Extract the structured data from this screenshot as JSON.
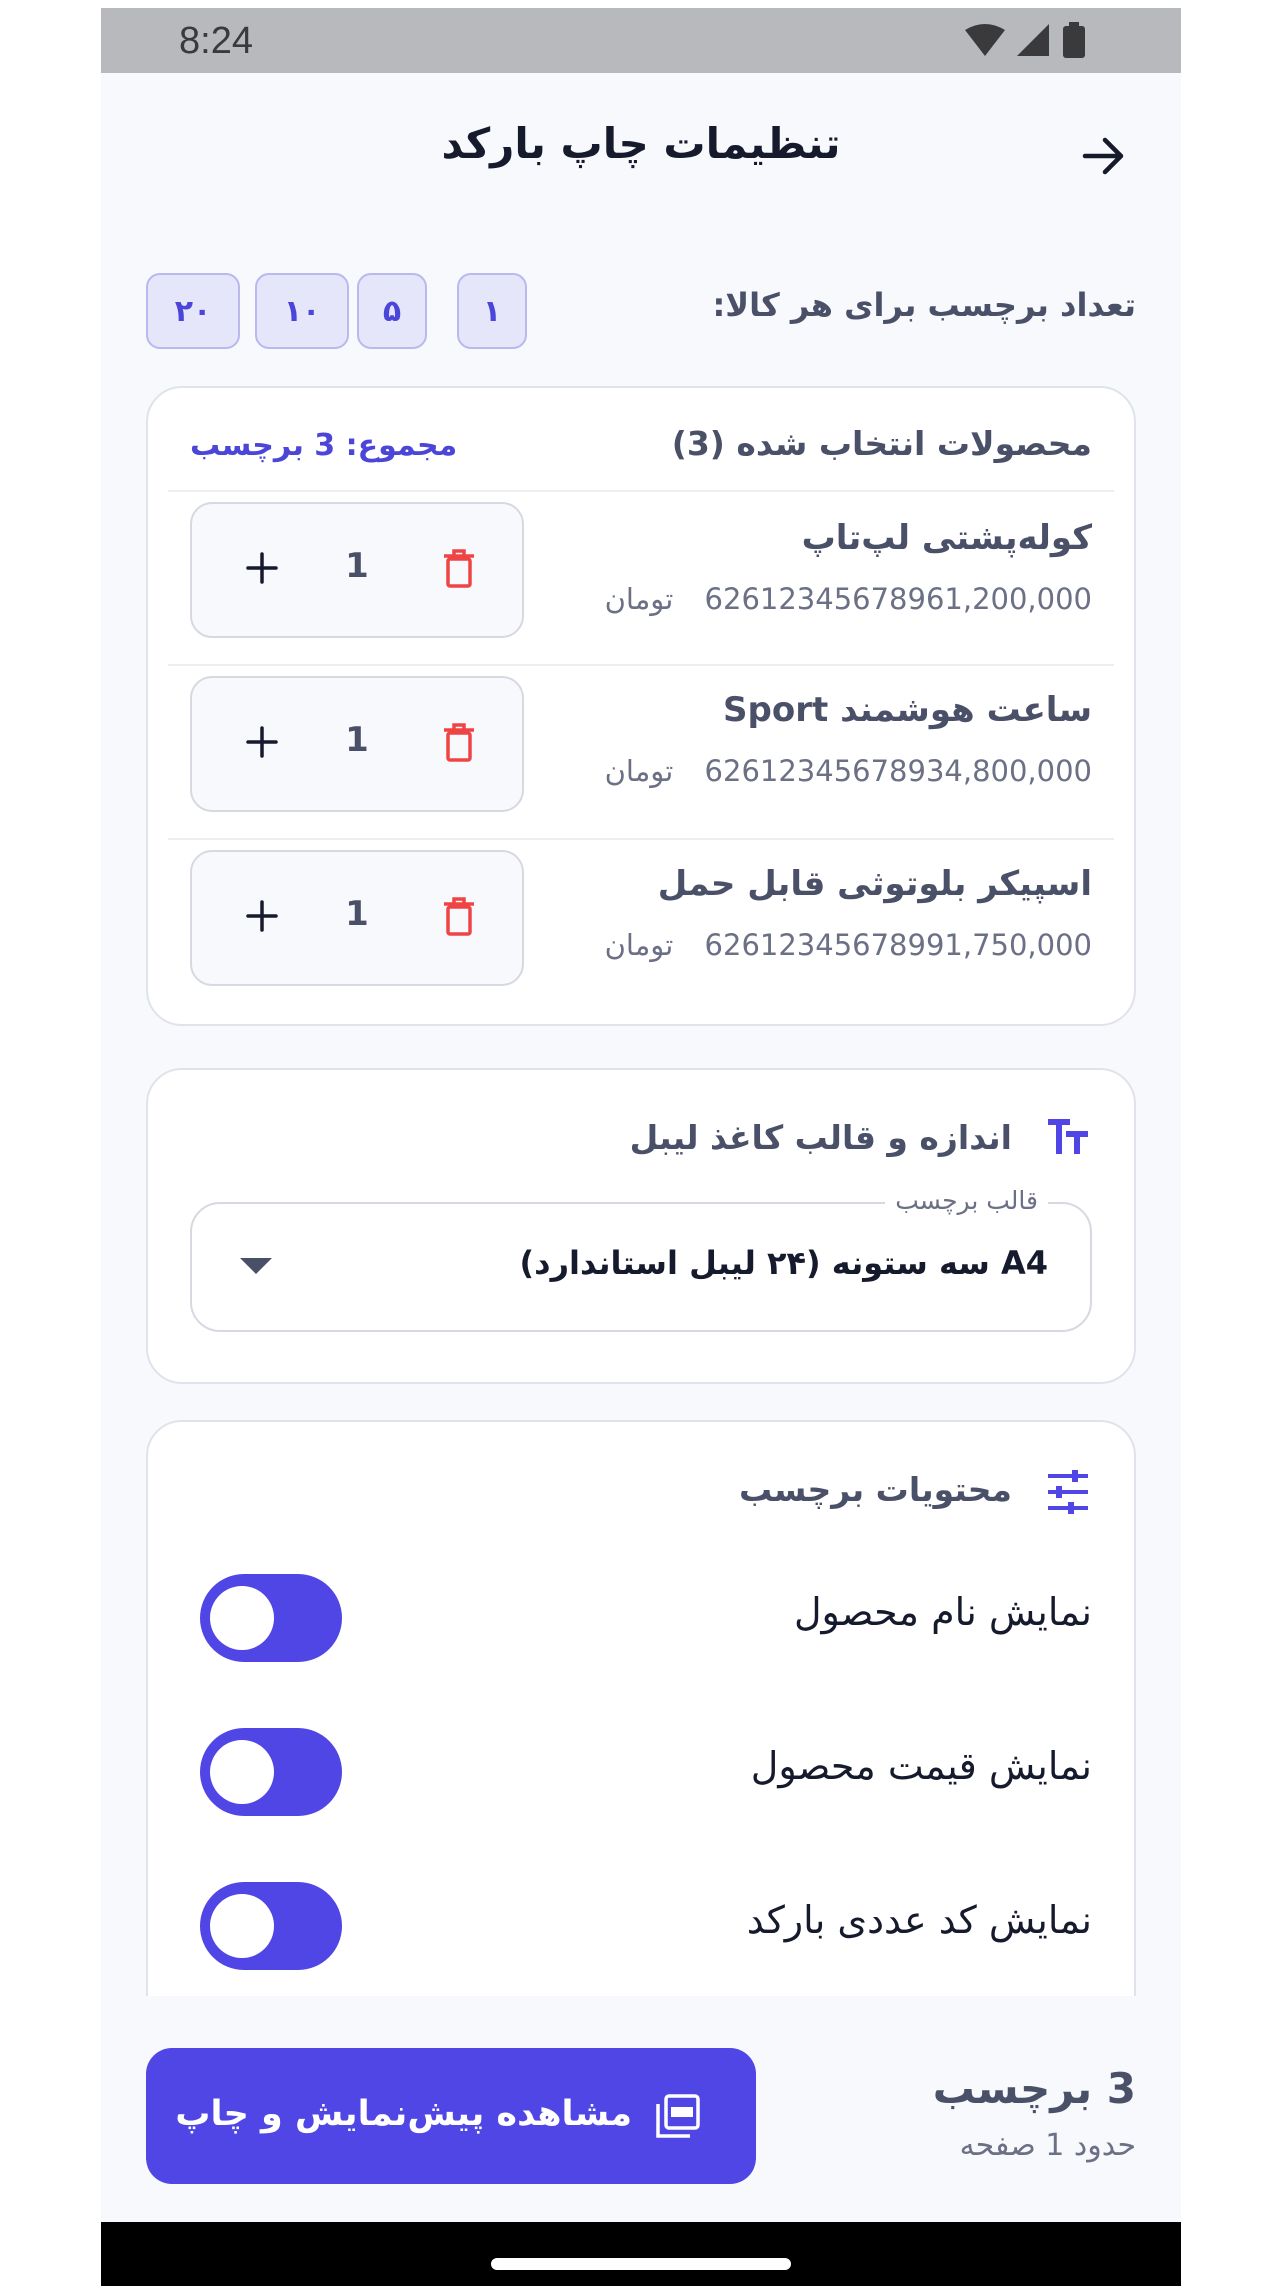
{
  "status_bar": {
    "time": "8:24"
  },
  "header": {
    "title": "تنظیمات چاپ بارکد"
  },
  "quantity": {
    "label": "تعداد برچسب برای هر کالا:",
    "chips": [
      "۱",
      "۵",
      "۱۰",
      "۲۰"
    ]
  },
  "products": {
    "title": "محصولات انتخاب شده (3)",
    "total": "مجموع: 3 برچسب",
    "items": [
      {
        "name": "کوله‌پشتی لپ‌تاپ",
        "barcode": "6261234567896",
        "price": "1,200,000 تومان",
        "qty": "1"
      },
      {
        "name": "ساعت هوشمند Sport",
        "barcode": "6261234567893",
        "price": "4,800,000 تومان",
        "qty": "1"
      },
      {
        "name": "اسپیکر بلوتوثی قابل حمل",
        "barcode": "6261234567899",
        "price": "1,750,000 تومان",
        "qty": "1"
      }
    ]
  },
  "label_size": {
    "title": "اندازه و قالب کاغذ لیبل",
    "field_label": "قالب برچسب",
    "selected": "A4 سه ستونه (۲۴ لیبل استاندارد)"
  },
  "label_content": {
    "title": "محتویات برچسب",
    "toggles": [
      {
        "label": "نمایش نام محصول",
        "on": true
      },
      {
        "label": "نمایش قیمت محصول",
        "on": true
      },
      {
        "label": "نمایش کد عددی بارکد",
        "on": true
      }
    ]
  },
  "footer": {
    "count": "3 برچسب",
    "pages": "حدود 1 صفحه",
    "button_label": "مشاهده پیش‌نمایش و چاپ"
  },
  "colors": {
    "accent": "#4f46e5",
    "danger": "#ef4444",
    "chip_bg": "#e6e6fb",
    "background": "#f8f9fc"
  },
  "icons": {
    "back": "arrow-right-icon",
    "delete": "trash-icon",
    "increment": "plus-icon",
    "size": "text-size-icon",
    "content": "sliders-icon",
    "print": "pdf-icon",
    "dropdown": "caret-down-icon"
  }
}
